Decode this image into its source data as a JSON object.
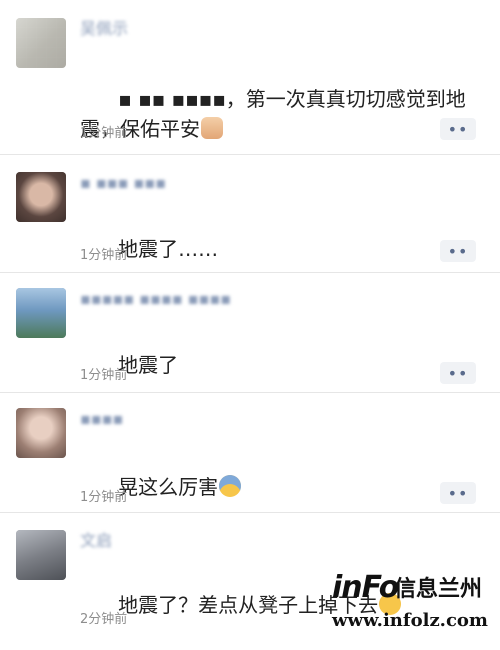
{
  "posts": [
    {
      "name": "吴佩示",
      "content": "▪ ▪▪ ▪▪▪▪，第一次真真切切感觉到地震，保佑平安",
      "emoji": "folded-hands",
      "time": "1分钟前",
      "more": "••"
    },
    {
      "name": "▪ ▪▪▪ ▪▪▪",
      "content": "地震了……",
      "emoji": "",
      "time": "1分钟前",
      "more": "••"
    },
    {
      "name": "▪▪▪▪▪ ▪▪▪▪ ▪▪▪▪",
      "content": "地震了",
      "emoji": "",
      "time": "1分钟前",
      "more": "••"
    },
    {
      "name": "▪▪▪▪",
      "content": "晃这么厉害",
      "emoji": "fearful-face",
      "time": "1分钟前",
      "more": "••"
    },
    {
      "name": "文启",
      "content": "地震了？差点从凳子上掉下去",
      "emoji": "grinning-sweat-face",
      "time": "2分钟前",
      "more": "••"
    }
  ],
  "watermark": {
    "logo": "inFo",
    "cn": "信息兰州",
    "url": "www.infolz.com"
  },
  "colors": {
    "name": "#8a9bb8",
    "text": "#222222",
    "meta": "#8e8e8e",
    "accent_red": "#d7262d"
  }
}
